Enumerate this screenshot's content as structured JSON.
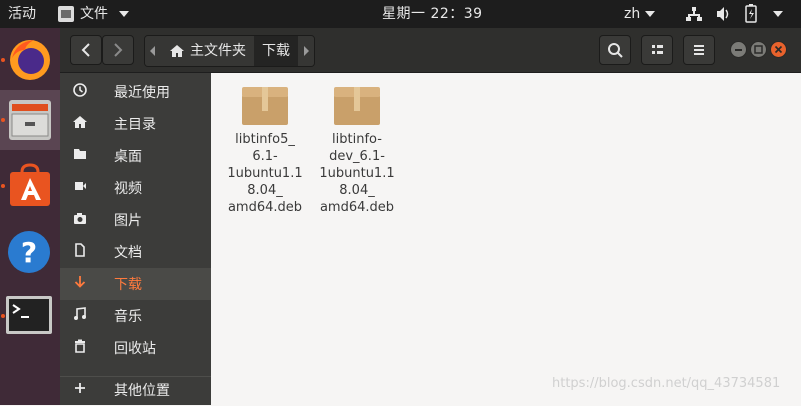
{
  "topbar": {
    "activities": "活动",
    "app_menu": "文件",
    "clock": "星期一 22：39",
    "language": "zh"
  },
  "dock": {
    "items": [
      "firefox-icon",
      "files-icon",
      "software-center-icon",
      "help-icon",
      "terminal-icon"
    ]
  },
  "headerbar": {
    "breadcrumbs": [
      {
        "label": "主文件夹"
      },
      {
        "label": "下载"
      }
    ]
  },
  "sidebar": {
    "items": [
      {
        "label": "最近使用",
        "icon": "clock-icon"
      },
      {
        "label": "主目录",
        "icon": "home-icon"
      },
      {
        "label": "桌面",
        "icon": "folder-icon"
      },
      {
        "label": "视频",
        "icon": "video-icon"
      },
      {
        "label": "图片",
        "icon": "camera-icon"
      },
      {
        "label": "文档",
        "icon": "document-icon"
      },
      {
        "label": "下载",
        "icon": "download-icon",
        "active": true
      },
      {
        "label": "音乐",
        "icon": "music-icon"
      },
      {
        "label": "回收站",
        "icon": "trash-icon"
      },
      {
        "label": "其他位置",
        "icon": "plus-icon"
      }
    ]
  },
  "files": [
    {
      "name": "libtinfo5_\n6.1-\n1ubuntu1.1\n8.04_\namd64.deb"
    },
    {
      "name": "libtinfo-\ndev_6.1-\n1ubuntu1.1\n8.04_\namd64.deb"
    }
  ],
  "watermark": "https://blog.csdn.net/qq_43734581",
  "colors": {
    "accent": "#e95420",
    "dock_bg": "#3f2a37",
    "sidebar_bg": "#3c3c3a",
    "headerbar_bg": "#2f2f2d"
  }
}
